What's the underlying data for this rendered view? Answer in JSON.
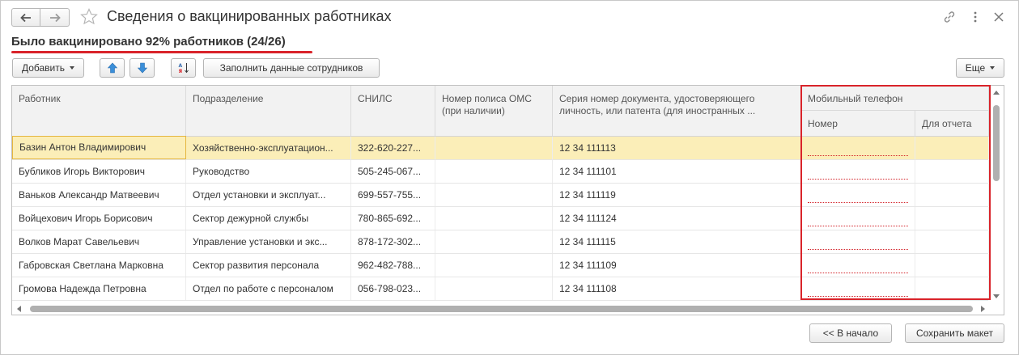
{
  "window": {
    "title": "Сведения о вакцинированных работниках"
  },
  "summary": {
    "text": "Было вакцинировано 92% работников (24/26)"
  },
  "toolbar": {
    "add_label": "Добавить",
    "fill_label": "Заполнить данные сотрудников",
    "more_label": "Еще"
  },
  "table": {
    "headers": {
      "worker": "Работник",
      "department": "Подразделение",
      "snils": "СНИЛС",
      "oms": "Номер полиса ОМС (при наличии)",
      "doc": "Серия номер документа, удостоверяющего личность, или патента (для иностранных ...",
      "mobile": "Мобильный телефон",
      "mobile_number": "Номер",
      "mobile_report": "Для отчета"
    },
    "rows": [
      {
        "worker": "Базин Антон Владимирович",
        "department": "Хозяйственно-эксплуатацион...",
        "snils": "322-620-227...",
        "oms": "",
        "doc": "12 34 111113"
      },
      {
        "worker": "Бубликов Игорь Викторович",
        "department": "Руководство",
        "snils": "505-245-067...",
        "oms": "",
        "doc": "12 34 111101"
      },
      {
        "worker": "Ваньков Александр Матвеевич",
        "department": "Отдел установки и эксплуат...",
        "snils": "699-557-755...",
        "oms": "",
        "doc": "12 34 111119"
      },
      {
        "worker": "Войцехович Игорь Борисович",
        "department": "Сектор дежурной службы",
        "snils": "780-865-692...",
        "oms": "",
        "doc": "12 34 111124"
      },
      {
        "worker": "Волков Марат Савельевич",
        "department": "Управление установки и экс...",
        "snils": "878-172-302...",
        "oms": "",
        "doc": "12 34 111115"
      },
      {
        "worker": "Габровская Светлана Марковна",
        "department": "Сектор развития персонала",
        "snils": "962-482-788...",
        "oms": "",
        "doc": "12 34 111109"
      },
      {
        "worker": "Громова Надежда Петровна",
        "department": "Отдел по работе с персоналом",
        "snils": "056-798-023...",
        "oms": "",
        "doc": "12 34 111108"
      }
    ]
  },
  "footer": {
    "back_label": "<< В начало",
    "save_label": "Сохранить макет"
  },
  "colors": {
    "accent_red": "#d9232a",
    "selected_row": "#fbeeb8",
    "arrow_blue": "#3b8fd9"
  }
}
